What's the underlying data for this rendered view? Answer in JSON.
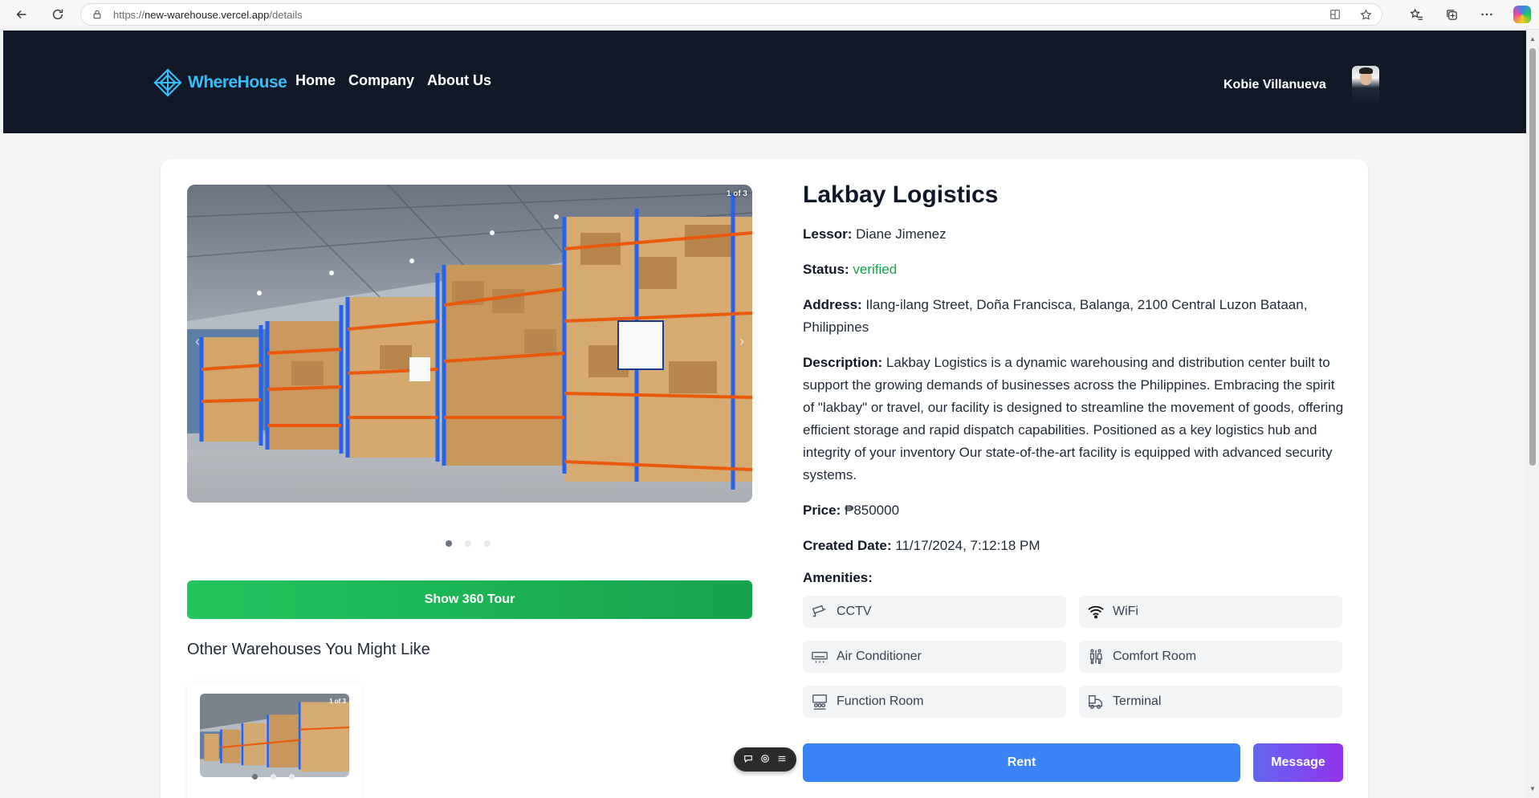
{
  "browser": {
    "url_prefix": "https://",
    "url_host": "new-warehouse.vercel.app",
    "url_path": "/details"
  },
  "header": {
    "logo_text": "WhereHouse",
    "nav": [
      "Home",
      "Company",
      "About Us"
    ],
    "user_name": "Kobie Villanueva"
  },
  "gallery": {
    "counter": "1 of 3",
    "slide_count": 3,
    "active_slide": 1
  },
  "tour_button": "Show 360 Tour",
  "other": {
    "title": "Other Warehouses You Might Like",
    "card_counter": "1 of 3"
  },
  "details": {
    "title": "Lakbay Logistics",
    "lessor_label": "Lessor:",
    "lessor": "Diane Jimenez",
    "status_label": "Status:",
    "status": "verified",
    "address_label": "Address:",
    "address": "Ilang-ilang Street, Doña Francisca, Balanga, 2100 Central Luzon Bataan, Philippines",
    "description_label": "Description:",
    "description": "Lakbay Logistics is a dynamic warehousing and distribution center built to support the growing demands of businesses across the Philippines. Embracing the spirit of \"lakbay\" or travel, our facility is designed to streamline the movement of goods, offering efficient storage and rapid dispatch capabilities. Positioned as a key logistics hub and integrity of your inventory Our state-of-the-art facility is equipped with advanced security systems.",
    "price_label": "Price:",
    "price": "₱850000",
    "created_label": "Created Date:",
    "created": "11/17/2024, 7:12:18 PM",
    "amenities_label": "Amenities:",
    "amenities": [
      "CCTV",
      "WiFi",
      "Air Conditioner",
      "Comfort Room",
      "Function Room",
      "Terminal"
    ]
  },
  "actions": {
    "rent": "Rent",
    "message": "Message"
  },
  "colors": {
    "header_bg": "#111827",
    "logo": "#38bdf8",
    "verified": "#16a34a",
    "tour_btn": "#22c55e",
    "rent_btn": "#3b82f6",
    "message_btn": "#7c3aed"
  }
}
